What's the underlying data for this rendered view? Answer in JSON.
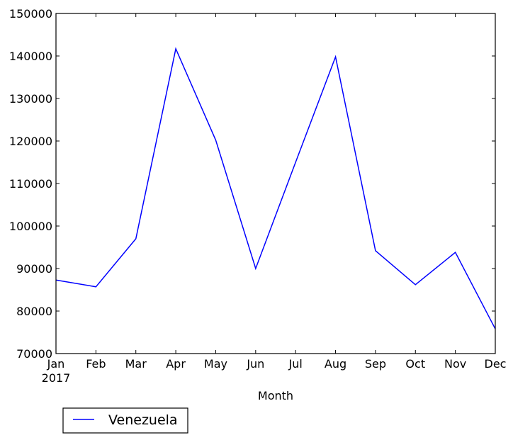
{
  "chart_data": {
    "type": "line",
    "title": "",
    "xlabel": "Month",
    "ylabel": "",
    "categories": [
      "Jan",
      "Feb",
      "Mar",
      "Apr",
      "May",
      "Jun",
      "Jul",
      "Aug",
      "Sep",
      "Oct",
      "Nov",
      "Dec"
    ],
    "x_sublabel": "2017",
    "series": [
      {
        "name": "Venezuela",
        "color": "#0000ff",
        "values": [
          87300,
          85700,
          97000,
          141700,
          120200,
          90000,
          115000,
          139800,
          94200,
          86200,
          93800,
          75800
        ]
      }
    ],
    "ylim": [
      70000,
      150000
    ],
    "yticks": [
      70000,
      80000,
      90000,
      100000,
      110000,
      120000,
      130000,
      140000,
      150000
    ],
    "ytick_labels": [
      "70000",
      "80000",
      "90000",
      "100000",
      "110000",
      "120000",
      "130000",
      "140000",
      "150000"
    ],
    "grid": false,
    "legend": {
      "position": "below-left",
      "entries": [
        "Venezuela"
      ]
    }
  }
}
